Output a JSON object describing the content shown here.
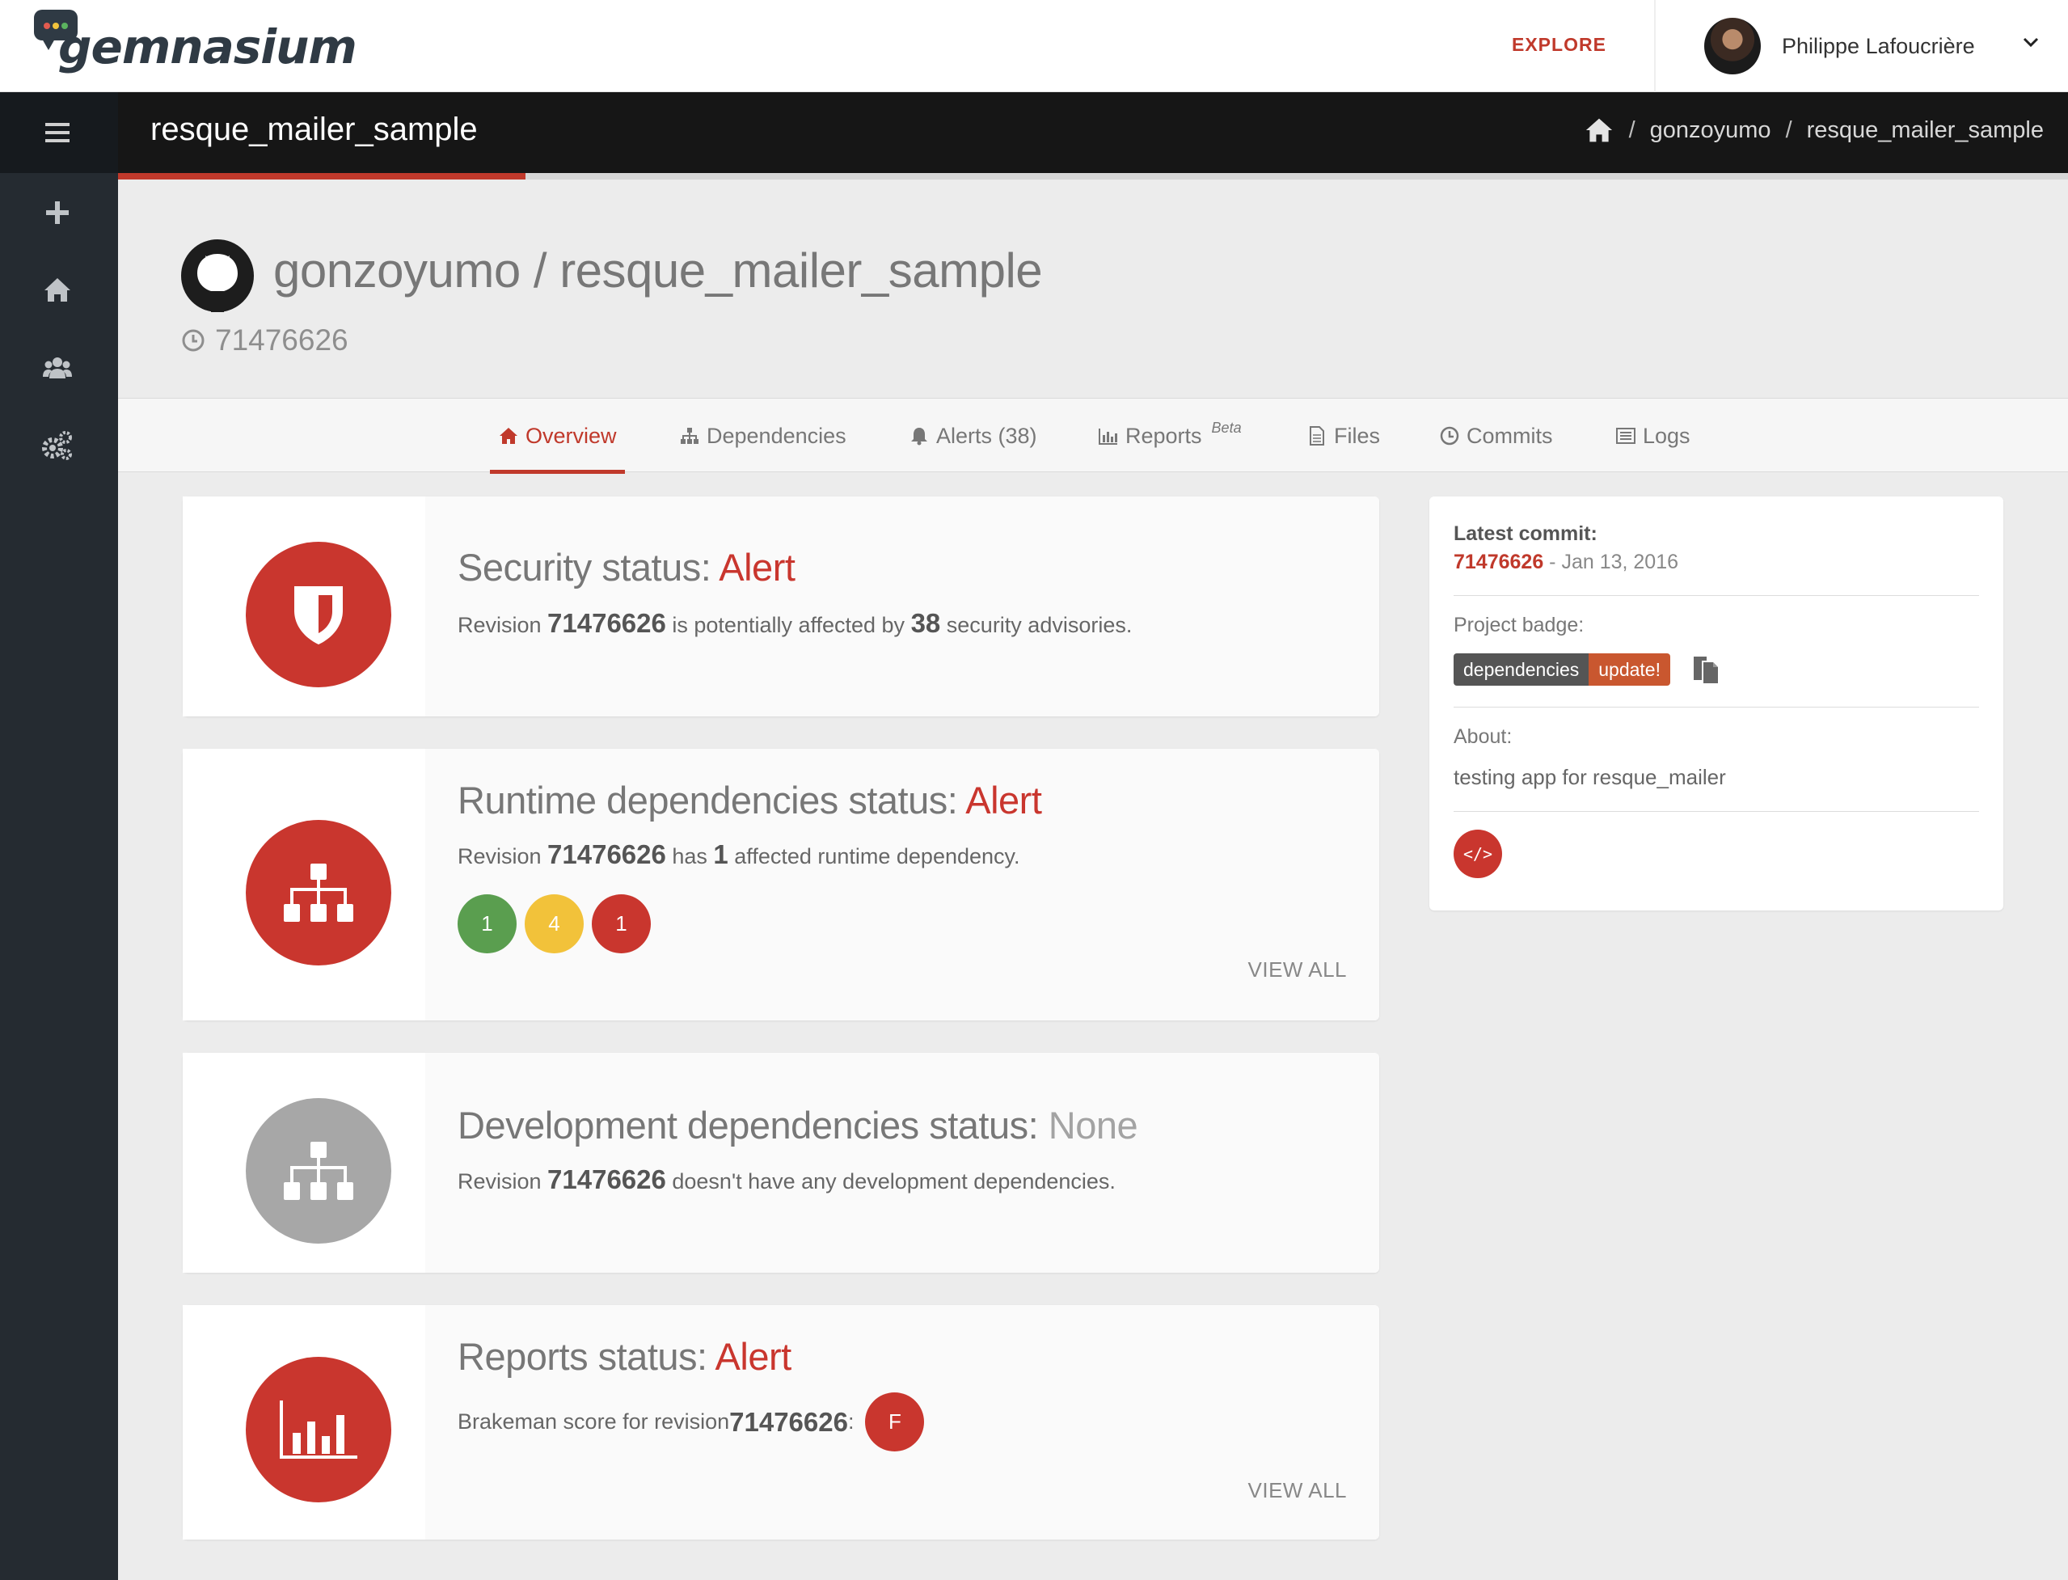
{
  "brand": {
    "logo_text": "gemnasium"
  },
  "topnav": {
    "explore_label": "EXPLORE",
    "user_name": "Philippe Lafoucrière"
  },
  "titlebar": {
    "project_name": "resque_mailer_sample",
    "breadcrumbs": [
      "gonzoyumo",
      "resque_mailer_sample"
    ]
  },
  "header": {
    "repo_title": "gonzoyumo / resque_mailer_sample",
    "revision": "71476626"
  },
  "tabs": [
    {
      "label": "Overview",
      "icon": "home-icon"
    },
    {
      "label": "Dependencies",
      "icon": "sitemap-icon"
    },
    {
      "label": "Alerts (38)",
      "icon": "bell-icon"
    },
    {
      "label": "Reports",
      "sup": "Beta",
      "icon": "bar-chart-icon"
    },
    {
      "label": "Files",
      "icon": "file-icon"
    },
    {
      "label": "Commits",
      "icon": "clock-icon"
    },
    {
      "label": "Logs",
      "icon": "list-icon"
    }
  ],
  "cards": {
    "security": {
      "title": "Security status: ",
      "status": "Alert",
      "pre": "Revision ",
      "revision": "71476626",
      "mid": " is potentially affected by ",
      "count": "38",
      "post": " security advisories."
    },
    "runtime": {
      "title": "Runtime dependencies status: ",
      "status": "Alert",
      "pre": "Revision ",
      "revision": "71476626",
      "mid": " has ",
      "count": "1",
      "post": " affected runtime dependency.",
      "counts": [
        "1",
        "4",
        "1"
      ],
      "view_all": "VIEW ALL"
    },
    "development": {
      "title": "Development dependencies status: ",
      "status": "None",
      "pre": "Revision ",
      "revision": "71476626",
      "post": " doesn't have any development dependencies."
    },
    "reports": {
      "title": "Reports status: ",
      "status": "Alert",
      "pre": "Brakeman score for revision ",
      "revision": "71476626",
      "post": ":",
      "score": "F",
      "view_all": "VIEW ALL"
    }
  },
  "info": {
    "latest_commit_label": "Latest commit:",
    "commit_sha": "71476626",
    "commit_date": " - Jan 13, 2016",
    "badge_label": "Project badge:",
    "badge_left": "dependencies",
    "badge_right": "update!",
    "about_label": "About:",
    "about_text": "testing app for resque_mailer",
    "embed_label": "</>"
  },
  "colors": {
    "accent": "#c0392b",
    "alert_red": "#c9362e",
    "ok_green": "#5a9e4f",
    "warn_yellow": "#f2c23a",
    "none_gray": "#a7a7a7"
  }
}
